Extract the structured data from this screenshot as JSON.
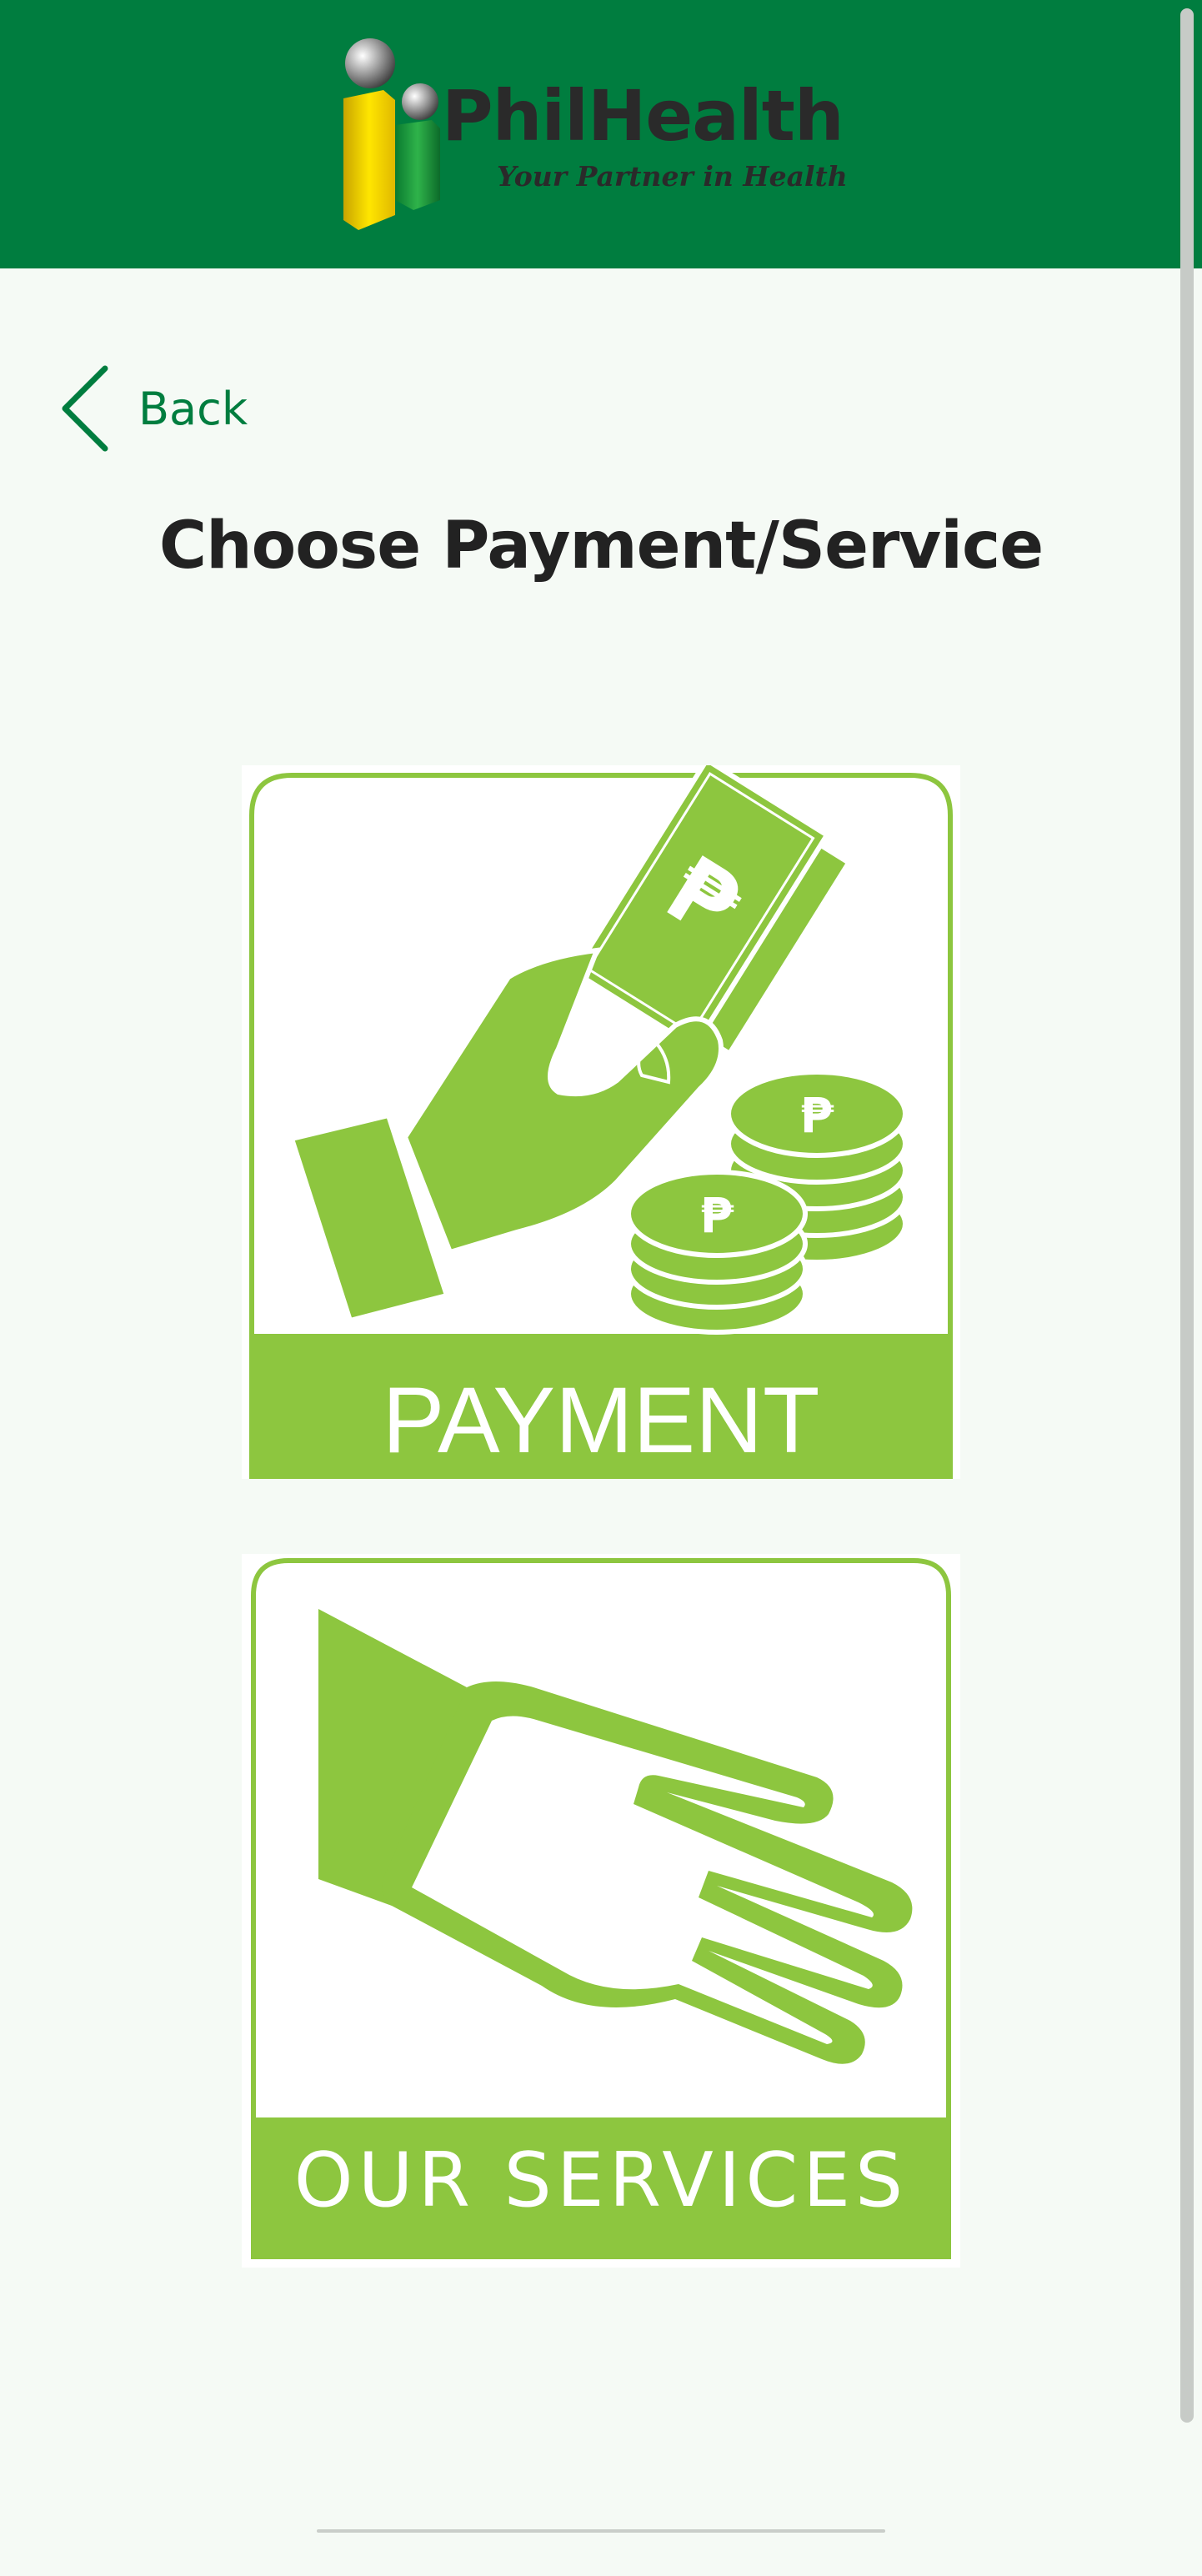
{
  "header": {
    "brand_name": "PhilHealth",
    "tagline": "Your Partner in Health"
  },
  "nav": {
    "back_label": "Back"
  },
  "page": {
    "title": "Choose Payment/Service"
  },
  "options": [
    {
      "label": "PAYMENT",
      "icon": "hand-with-money-icon"
    },
    {
      "label": "OUR SERVICES",
      "icon": "open-hand-icon"
    }
  ],
  "colors": {
    "header_bg": "#007d3f",
    "accent_green": "#8dc63f",
    "back_green": "#007d3f",
    "page_bg": "#f5faf5"
  }
}
